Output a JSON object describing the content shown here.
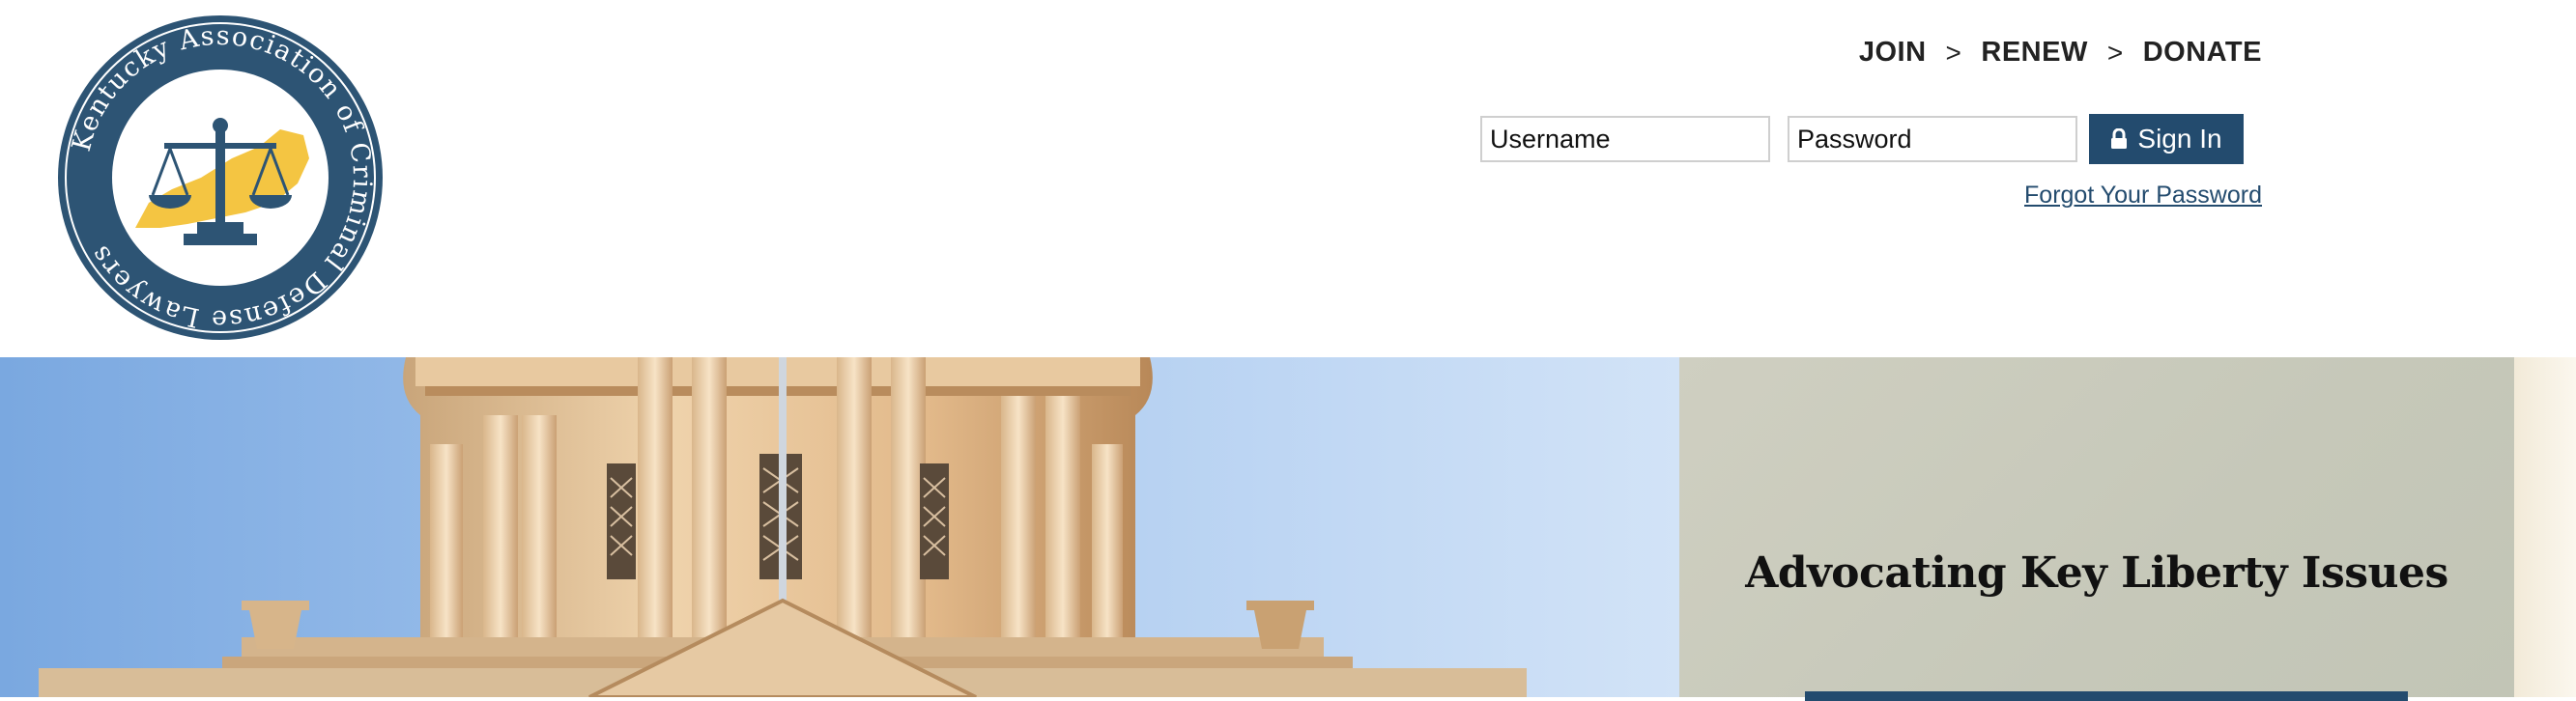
{
  "logo": {
    "text": "Kentucky Association of Criminal Defense Lawyers",
    "ring_color": "#2d5474",
    "state_color": "#f4c542"
  },
  "nav": {
    "join": "JOIN",
    "renew": "RENEW",
    "donate": "DONATE",
    "separator": ">"
  },
  "login": {
    "username_placeholder": "Username",
    "password_placeholder": "Password",
    "signin_label": "Sign In",
    "forgot_label": "Forgot Your Password"
  },
  "hero": {
    "heading": "Advocating Key Liberty Issues"
  },
  "colors": {
    "brand": "#234b6e",
    "panel_bg": "#c8cabb",
    "sky": "#8fb6e6"
  }
}
